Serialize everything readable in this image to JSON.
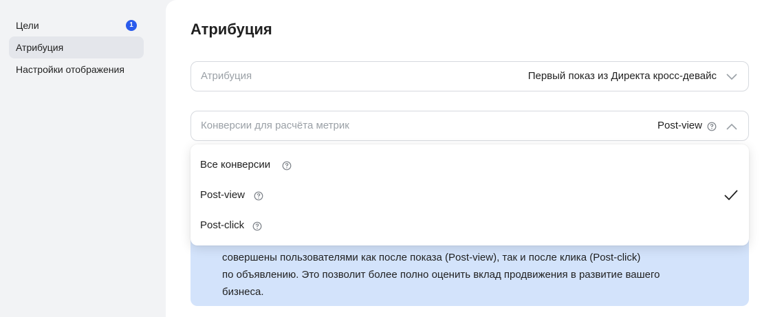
{
  "sidebar": {
    "items": [
      {
        "label": "Цели",
        "badge": "1"
      },
      {
        "label": "Атрибуция"
      },
      {
        "label": "Настройки отображения"
      }
    ]
  },
  "main": {
    "title": "Атрибуция",
    "attribution_select": {
      "placeholder": "Атрибуция",
      "value": "Первый показ из Директа кросс-девайс"
    },
    "conversions_select": {
      "placeholder": "Конверсии для расчёта метрик",
      "value": "Post-view"
    },
    "dropdown": {
      "options": [
        {
          "label": "Все конверсии",
          "selected": false
        },
        {
          "label": "Post-view",
          "selected": true
        },
        {
          "label": "Post-click",
          "selected": false
        }
      ]
    },
    "info": {
      "lines": [
        "совершены пользователями как после показа (Post-view), так и после клика (Post-click)",
        "по объявлению. Это позволит более полно оценить вклад продвижения в развитие вашего",
        "бизнеса."
      ]
    }
  },
  "colors": {
    "accent": "#2a5bec",
    "info_bg": "#d3e3fb",
    "active_nav": "#e4e6eb"
  }
}
